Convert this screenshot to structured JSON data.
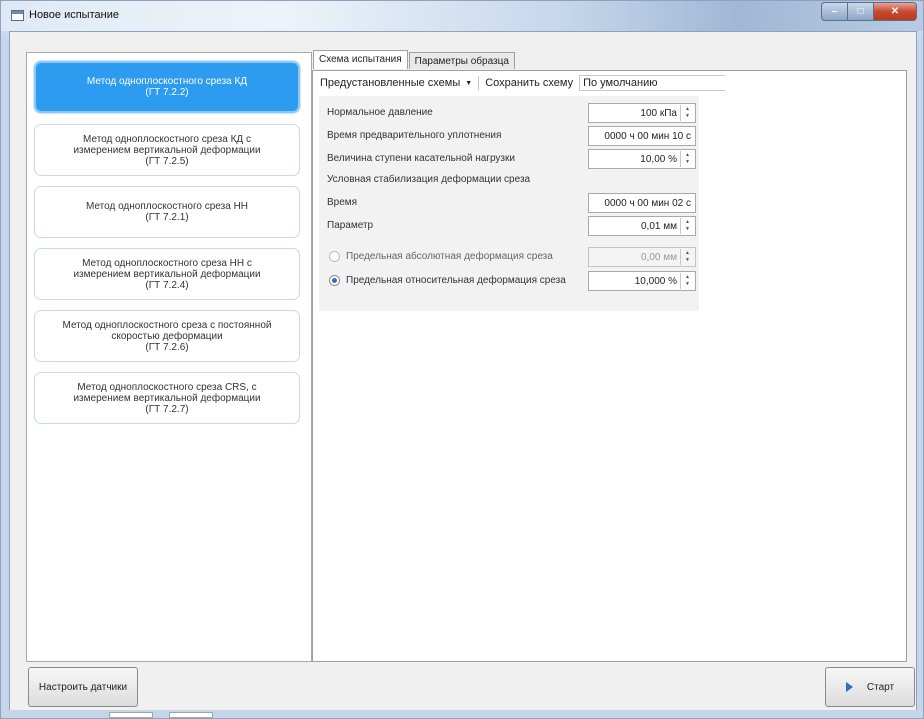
{
  "window": {
    "title": "Новое испытание"
  },
  "methods": [
    {
      "lines": [
        "Метод одноплоскостного среза КД",
        "(ГТ 7.2.2)"
      ],
      "selected": true
    },
    {
      "lines": [
        "Метод одноплоскостного среза КД с",
        "измерением вертикальной деформации",
        "(ГТ 7.2.5)"
      ],
      "selected": false
    },
    {
      "lines": [
        "Метод одноплоскостного среза НН",
        "(ГТ 7.2.1)"
      ],
      "selected": false
    },
    {
      "lines": [
        "Метод одноплоскостного среза НН с",
        "измерением вертикальной деформации",
        "(ГТ 7.2.4)"
      ],
      "selected": false
    },
    {
      "lines": [
        "Метод одноплоскостного среза с постоянной",
        "скоростью деформации",
        "(ГТ 7.2.6)"
      ],
      "selected": false
    },
    {
      "lines": [
        "Метод одноплоскостного среза CRS, с",
        "измерением вертикальной деформации",
        "(ГТ 7.2.7)"
      ],
      "selected": false
    }
  ],
  "tabs": [
    {
      "label": "Схема испытания",
      "active": true
    },
    {
      "label": "Параметры образца",
      "active": false
    }
  ],
  "toolbar": {
    "presets_label": "Предустановленные схемы",
    "save_label": "Сохранить схему",
    "scheme_name": "По умолчанию"
  },
  "params": {
    "normal_pressure_label": "Нормальное давление",
    "normal_pressure_value": "100 кПа",
    "preconsolidation_time_label": "Время предварительного уплотнения",
    "preconsolidation_time_value": "0000 ч 00 мин 10 с",
    "shear_step_label": "Величина ступени касательной нагрузки",
    "shear_step_value": "10,00 %",
    "stabilization_header": "Условная стабилизация деформации среза",
    "stab_time_label": "Время",
    "stab_time_value": "0000 ч 00 мин 02 с",
    "stab_param_label": "Параметр",
    "stab_param_value": "0,01 мм",
    "abs_limit_label": "Предельная абсолютная деформация среза",
    "abs_limit_value": "0,00 мм",
    "abs_limit_checked": false,
    "rel_limit_label": "Предельная относительная деформация среза",
    "rel_limit_value": "10,000 %",
    "rel_limit_checked": true
  },
  "buttons": {
    "sensors_label": "Настроить датчики",
    "start_label": "Старт"
  },
  "icons": {
    "start": "play-icon",
    "spinner": "spinner-arrows-icon",
    "window": "window-icon"
  },
  "colors": {
    "selected_method": "#2d9bf0",
    "accent": "#2f6fbf"
  }
}
